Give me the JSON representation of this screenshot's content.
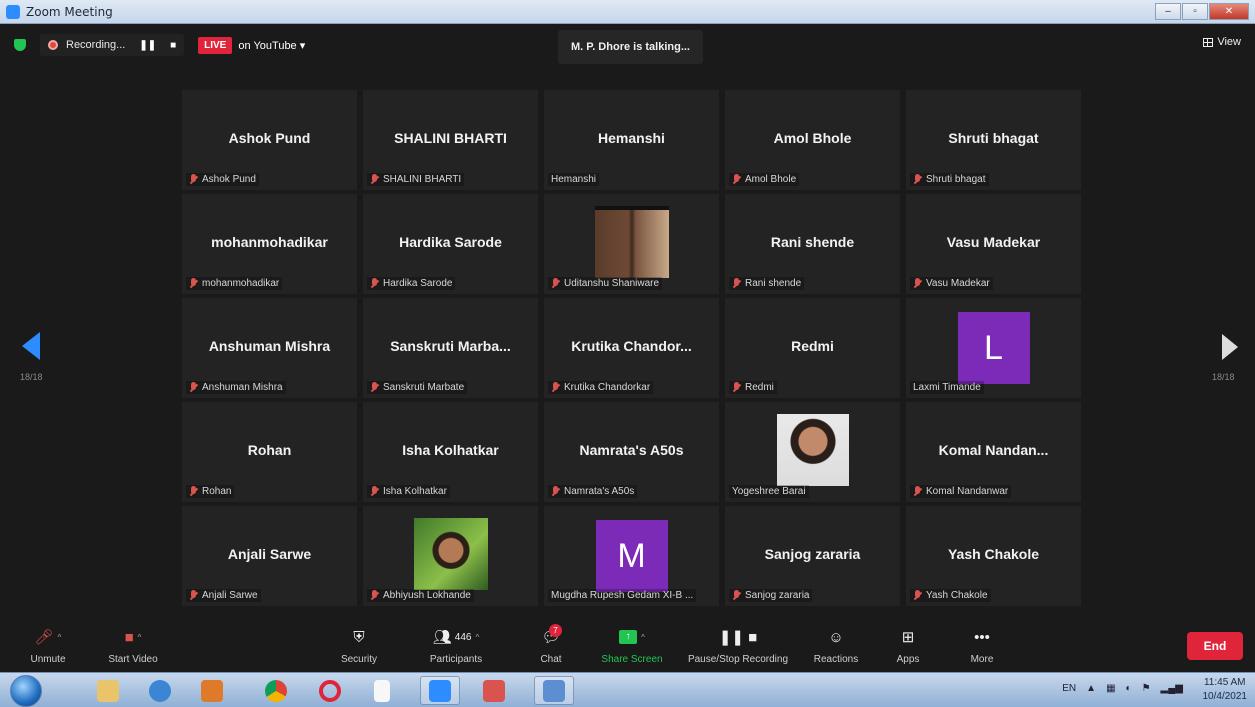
{
  "window": {
    "title": "Zoom Meeting",
    "buttons": [
      "–",
      "▫",
      "✕"
    ]
  },
  "status": {
    "recording_label": "Recording...",
    "live_badge": "LIVE",
    "live_target": "on YouTube ▾",
    "talking": "M. P. Dhore is talking...",
    "view_label": "View"
  },
  "pager": {
    "left": "18/18",
    "right": "18/18"
  },
  "tiles": [
    {
      "big": "Ashok Pund",
      "name": "Ashok Pund",
      "muted": true
    },
    {
      "big": "SHALINI BHARTI",
      "name": "SHALINI BHARTI",
      "muted": true
    },
    {
      "big": "Hemanshi",
      "name": "Hemanshi",
      "muted": false
    },
    {
      "big": "Amol Bhole",
      "name": "Amol Bhole",
      "muted": true
    },
    {
      "big": "Shruti bhagat",
      "name": "Shruti bhagat",
      "muted": true
    },
    {
      "big": "mohanmohadikar",
      "name": "mohanmohadikar",
      "muted": true
    },
    {
      "big": "Hardika Sarode",
      "name": "Hardika Sarode",
      "muted": true
    },
    {
      "photo": "kids",
      "name": "Uditanshu Shaniware",
      "muted": true
    },
    {
      "big": "Rani shende",
      "name": "Rani shende",
      "muted": true
    },
    {
      "big": "Vasu Madekar",
      "name": "Vasu Madekar",
      "muted": true
    },
    {
      "big": "Anshuman Mishra",
      "name": "Anshuman Mishra",
      "muted": true
    },
    {
      "big": "Sanskruti  Marba...",
      "name": "Sanskruti Marbate",
      "muted": true
    },
    {
      "big": "Krutika  Chandor...",
      "name": "Krutika Chandorkar",
      "muted": true
    },
    {
      "big": "Redmi",
      "name": "Redmi",
      "muted": true
    },
    {
      "letter": "L",
      "name": "Laxmi Timande",
      "muted": false
    },
    {
      "big": "Rohan",
      "name": "Rohan",
      "muted": true
    },
    {
      "big": "Isha Kolhatkar",
      "name": "Isha Kolhatkar",
      "muted": true
    },
    {
      "big": "Namrata's A50s",
      "name": "Namrata's A50s",
      "muted": true
    },
    {
      "photo": "girl",
      "name": "Yogeshree Barai",
      "muted": false
    },
    {
      "big": "Komal  Nandan...",
      "name": "Komal Nandanwar",
      "muted": true
    },
    {
      "big": "Anjali Sarwe",
      "name": "Anjali Sarwe",
      "muted": true
    },
    {
      "photo": "boy",
      "name": "Abhiyush Lokhande",
      "muted": true
    },
    {
      "letter": "M",
      "name": "Mugdha Rupesh Gedam XI-B ...",
      "muted": false
    },
    {
      "big": "Sanjog zararia",
      "name": "Sanjog zararia",
      "muted": true
    },
    {
      "big": "Yash Chakole",
      "name": "Yash Chakole",
      "muted": true
    }
  ],
  "toolbar": {
    "unmute": "Unmute",
    "start_video": "Start Video",
    "security": "Security",
    "participants": "Participants",
    "participants_count": "446",
    "chat": "Chat",
    "chat_badge": "7",
    "share_screen": "Share Screen",
    "pause_stop": "Pause/Stop Recording",
    "reactions": "Reactions",
    "apps": "Apps",
    "more": "More",
    "end": "End"
  },
  "taskbar": {
    "lang": "EN",
    "time": "11:45 AM",
    "date": "10/4/2021"
  }
}
